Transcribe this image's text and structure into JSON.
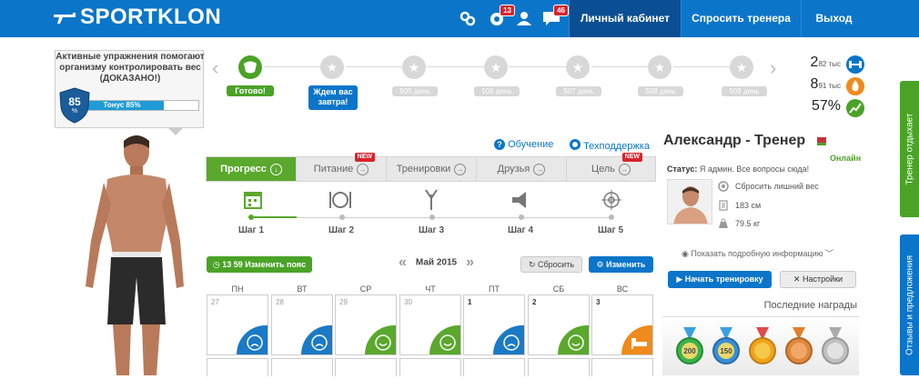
{
  "header": {
    "logo": "SPORTKLON",
    "badge_bell": "13",
    "badge_messages": "46",
    "nav": {
      "cabinet": "Личный кабинет",
      "ask_trainer": "Спросить тренера",
      "exit": "Выход"
    }
  },
  "info_box": {
    "text": "Активные упражнения помогают организму контролировать вес (ДОКАЗАНО!)",
    "shield_value": "85",
    "shield_unit": "%",
    "tone_label": "Тонус 85%",
    "tone_percent": 85
  },
  "timeline": {
    "done_label": "Готово!",
    "wait_label": "Ждем вас завтра!",
    "days": [
      "505 день",
      "506 день",
      "507 день",
      "508 день",
      "509 день"
    ]
  },
  "stats": [
    {
      "value": "2",
      "unit": "82 тыс"
    },
    {
      "value": "8",
      "unit": "91 тыс"
    },
    {
      "value": "57%",
      "unit": ""
    }
  ],
  "links": {
    "learning": "Обучение",
    "support": "Техподдержка"
  },
  "tabs": [
    {
      "label": "Прогресс",
      "new": false
    },
    {
      "label": "Питание",
      "new": true
    },
    {
      "label": "Тренировки",
      "new": false
    },
    {
      "label": "Друзья",
      "new": false
    },
    {
      "label": "Цель",
      "new": true
    }
  ],
  "new_badge": "NEW",
  "steps": [
    "Шаг 1",
    "Шаг 2",
    "Шаг 3",
    "Шаг 4",
    "Шаг 5"
  ],
  "calendar": {
    "belt_button": "13 59 Изменить пояс",
    "month": "Май 2015",
    "reset": "Сбросить",
    "change": "Изменить",
    "weekdays": [
      "ПН",
      "ВТ",
      "СР",
      "ЧТ",
      "ПТ",
      "СБ",
      "ВС"
    ],
    "days": [
      "27",
      "28",
      "29",
      "30",
      "1",
      "2",
      "3"
    ]
  },
  "trainer": {
    "name": "Александр - Тренер",
    "online": "Онлайн",
    "status_label": "Статус:",
    "status_text": "Я админ. Все вопросы сюда!",
    "goal": "Сбросить лишний вес",
    "height": "183 см",
    "weight": "79.5 кг",
    "more_info": "Показать подробную информацию",
    "start_button": "Начать тренировку",
    "settings_button": "Настройки",
    "awards_title": "Последние награды",
    "medals": [
      "200",
      "150",
      "",
      "",
      ""
    ]
  },
  "side_tabs": {
    "trainer_rest": "Тренер отдыхает",
    "feedback": "Отзывы и предложения"
  },
  "colors": {
    "header": "#0b75c9",
    "green": "#4aa326",
    "blue": "#0b75c9",
    "orange": "#f08a1c",
    "red": "#d9232d"
  }
}
